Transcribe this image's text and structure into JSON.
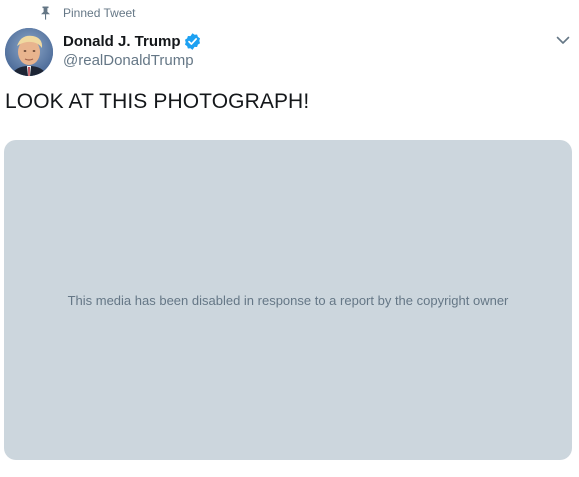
{
  "pinned": {
    "label": "Pinned Tweet",
    "icon": "pin-icon"
  },
  "author": {
    "display_name": "Donald J. Trump",
    "handle": "@realDonaldTrump",
    "verified": true,
    "verified_icon": "verified-badge-icon",
    "avatar_icon": "avatar"
  },
  "menu": {
    "icon": "chevron-down-icon"
  },
  "tweet": {
    "text": "LOOK AT THIS PHOTOGRAPH!"
  },
  "media": {
    "notice": "This media has been disabled in response to a report by the copyright owner"
  },
  "colors": {
    "text_primary": "#14171a",
    "text_secondary": "#657786",
    "verified_blue": "#1da1f2",
    "media_placeholder": "#ccd6dd"
  }
}
